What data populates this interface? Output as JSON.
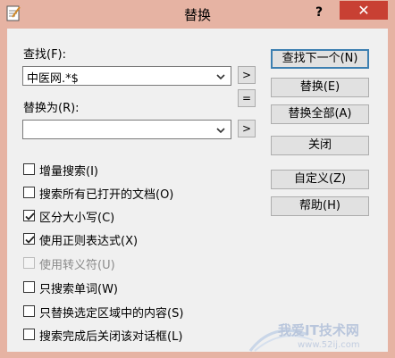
{
  "window": {
    "title": "替换",
    "help": "?",
    "close": "✕"
  },
  "find": {
    "label": "查找(F):",
    "value": "中医网.*$"
  },
  "replace": {
    "label": "替换为(R):",
    "value": ""
  },
  "side": {
    "arrow": ">",
    "equals": "="
  },
  "buttons": {
    "find_next": "查找下一个(N)",
    "replace": "替换(E)",
    "replace_all": "替换全部(A)",
    "close": "关闭",
    "custom": "自定义(Z)",
    "help": "帮助(H)"
  },
  "options": [
    {
      "label": "增量搜索(I)",
      "checked": false,
      "disabled": false
    },
    {
      "label": "搜索所有已打开的文档(O)",
      "checked": false,
      "disabled": false
    },
    {
      "label": "区分大小写(C)",
      "checked": true,
      "disabled": false
    },
    {
      "label": "使用正则表达式(X)",
      "checked": true,
      "disabled": false
    },
    {
      "label": "使用转义符(U)",
      "checked": false,
      "disabled": true
    },
    {
      "label": "只搜索单词(W)",
      "checked": false,
      "disabled": false
    },
    {
      "label": "只替换选定区域中的内容(S)",
      "checked": false,
      "disabled": false
    },
    {
      "label": "搜索完成后关闭该对话框(L)",
      "checked": false,
      "disabled": false
    }
  ],
  "watermark": {
    "line1": "我爱IT技术网",
    "line2": "www.52ij.com"
  },
  "colors": {
    "titlebar": "#e6b3a3",
    "close": "#c84033"
  }
}
